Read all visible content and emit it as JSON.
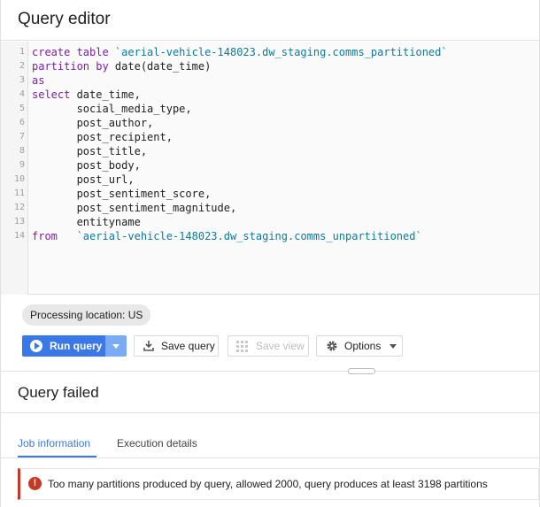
{
  "header": {
    "title": "Query editor"
  },
  "editor": {
    "lines": [
      {
        "n": "1",
        "segments": [
          {
            "t": "create table ",
            "c": "kw"
          },
          {
            "t": "`aerial-vehicle-148023.dw_staging.comms_partitioned`",
            "c": "str"
          }
        ]
      },
      {
        "n": "2",
        "segments": [
          {
            "t": "partition by ",
            "c": "kw"
          },
          {
            "t": "date(date_time)",
            "c": ""
          }
        ]
      },
      {
        "n": "3",
        "segments": [
          {
            "t": "as",
            "c": "kw"
          }
        ]
      },
      {
        "n": "4",
        "segments": [
          {
            "t": "select ",
            "c": "kw"
          },
          {
            "t": "date_time,",
            "c": ""
          }
        ]
      },
      {
        "n": "5",
        "segments": [
          {
            "t": "       social_media_type,",
            "c": ""
          }
        ]
      },
      {
        "n": "6",
        "segments": [
          {
            "t": "       post_author,",
            "c": ""
          }
        ]
      },
      {
        "n": "7",
        "segments": [
          {
            "t": "       post_recipient,",
            "c": ""
          }
        ]
      },
      {
        "n": "8",
        "segments": [
          {
            "t": "       post_title,",
            "c": ""
          }
        ]
      },
      {
        "n": "9",
        "segments": [
          {
            "t": "       post_body,",
            "c": ""
          }
        ]
      },
      {
        "n": "10",
        "segments": [
          {
            "t": "       post_url,",
            "c": ""
          }
        ]
      },
      {
        "n": "11",
        "segments": [
          {
            "t": "       post_sentiment_score,",
            "c": ""
          }
        ]
      },
      {
        "n": "12",
        "segments": [
          {
            "t": "       post_sentiment_magnitude,",
            "c": ""
          }
        ]
      },
      {
        "n": "13",
        "segments": [
          {
            "t": "       entityname",
            "c": ""
          }
        ]
      },
      {
        "n": "14",
        "segments": [
          {
            "t": "from   ",
            "c": "kw"
          },
          {
            "t": "`aerial-vehicle-148023.dw_staging.comms_unpartitioned`",
            "c": "str"
          }
        ]
      }
    ]
  },
  "processing_location": "Processing location: US",
  "toolbar": {
    "run_label": "Run query",
    "save_label": "Save query",
    "save_view_label": "Save view",
    "options_label": "Options"
  },
  "result": {
    "title": "Query failed",
    "tabs": [
      {
        "label": "Job information",
        "active": true
      },
      {
        "label": "Execution details",
        "active": false
      }
    ],
    "error_message": "Too many partitions produced by query, allowed 2000, query produces at least 3198 partitions"
  },
  "colors": {
    "accent": "#3b78e7",
    "error": "#c53929",
    "keyword": "#7b1fa2",
    "string": "#0d7a9a"
  }
}
